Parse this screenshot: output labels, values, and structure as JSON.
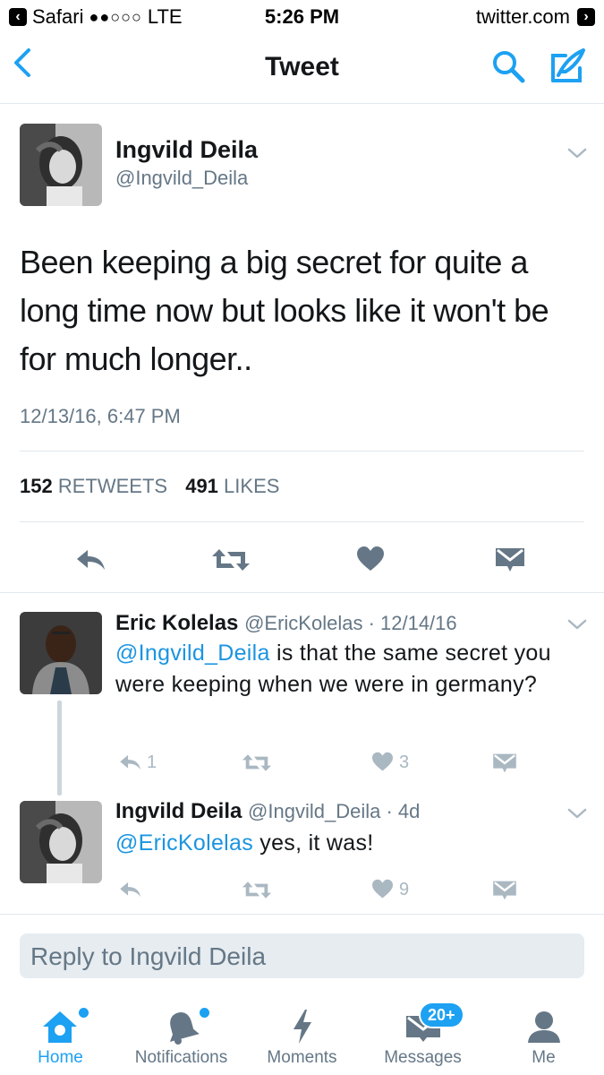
{
  "status_bar": {
    "app": "Safari",
    "signal": "●●○○○",
    "network": "LTE",
    "time": "5:26 PM",
    "site": "twitter.com"
  },
  "nav": {
    "title": "Tweet",
    "icons": [
      "back-chevron-icon",
      "search-icon",
      "compose-icon"
    ]
  },
  "main_tweet": {
    "name": "Ingvild Deila",
    "handle": "@Ingvild_Deila",
    "text": "Been keeping a big secret for quite a long time now but looks like it won't be for much longer..",
    "timestamp": "12/13/16, 6:47 PM",
    "retweets_count": "152",
    "retweets_label": "RETWEETS",
    "likes_count": "491",
    "likes_label": "LIKES"
  },
  "replies": [
    {
      "name": "Eric Kolelas",
      "meta": "@EricKolelas · 12/14/16",
      "mention": "@Ingvild_Deila",
      "text": " is that the same secret you were keeping when we were in germany?",
      "reply_count": "1",
      "retweet_count": "",
      "like_count": "3"
    },
    {
      "name": "Ingvild Deila",
      "meta": "@Ingvild_Deila · 4d",
      "mention": "@EricKolelas",
      "text": " yes, it was!",
      "reply_count": "",
      "retweet_count": "",
      "like_count": "9"
    }
  ],
  "reply_box": {
    "placeholder": "Reply to Ingvild Deila"
  },
  "tabs": [
    {
      "label": "Home",
      "icon": "home-icon",
      "active": true
    },
    {
      "label": "Notifications",
      "icon": "bell-icon",
      "active": false
    },
    {
      "label": "Moments",
      "icon": "lightning-icon",
      "active": false
    },
    {
      "label": "Messages",
      "icon": "messages-icon",
      "active": false,
      "badge": "20+"
    },
    {
      "label": "Me",
      "icon": "person-icon",
      "active": false
    }
  ],
  "colors": {
    "accent": "#1da1f2",
    "link": "#1b95e0",
    "muted": "#657786",
    "icon_dark": "#657786",
    "icon_light": "#aab8c2"
  }
}
